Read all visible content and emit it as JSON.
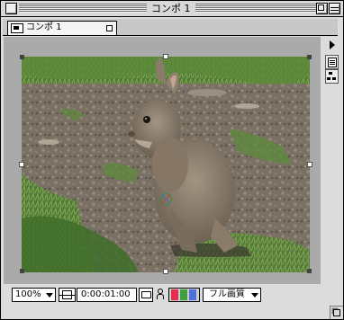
{
  "window": {
    "title": "コンポ 1"
  },
  "tab": {
    "label": "コンポ 1"
  },
  "bottom_bar": {
    "zoom_value": "100%",
    "timecode": "0:00:01:00",
    "resolution": "フル画質"
  },
  "icons": {
    "tab": "composition-icon",
    "panel_menu": "panel-menu-arrow-icon",
    "render": "render-queue-icon",
    "flowchart": "flowchart-icon",
    "safe_zones": "title-action-safe-icon",
    "snapshot": "camera-icon",
    "show_snapshot": "person-icon",
    "channels": "rgb-channels-icon"
  },
  "colors": {
    "window_bg": "#dcdcdc",
    "pasteboard": "#aaaaaa",
    "channel_red": "#e0304a",
    "channel_green": "#40a040",
    "channel_blue": "#5070d8"
  }
}
